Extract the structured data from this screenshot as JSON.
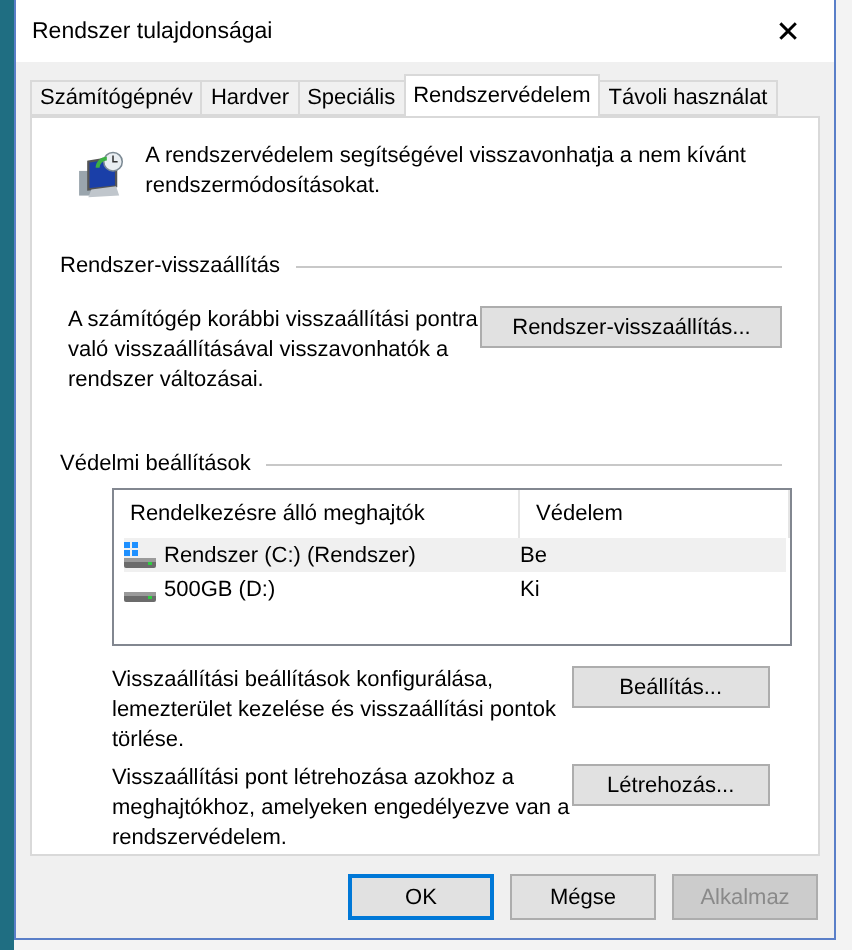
{
  "window": {
    "title": "Rendszer tulajdonságai",
    "close": "✕"
  },
  "tabs": [
    {
      "label": "Számítógépnév",
      "selected": false
    },
    {
      "label": "Hardver",
      "selected": false
    },
    {
      "label": "Speciális",
      "selected": false
    },
    {
      "label": "Rendszervédelem",
      "selected": true
    },
    {
      "label": "Távoli használat",
      "selected": false
    }
  ],
  "intro": "A rendszervédelem segítségével visszavonhatja a nem kívánt rendszermódosításokat.",
  "restore": {
    "heading": "Rendszer-visszaállítás",
    "text": "A számítógép korábbi visszaállítási pontra való visszaállításával visszavonhatók a rendszer változásai.",
    "button": "Rendszer-visszaállítás..."
  },
  "protection": {
    "heading": "Védelmi beállítások",
    "columns": [
      "Rendelkezésre álló meghajtók",
      "Védelem"
    ],
    "rows": [
      {
        "drive": "Rendszer (C:) (Rendszer)",
        "kind": "system",
        "status": "Be",
        "selected": true
      },
      {
        "drive": "500GB (D:)",
        "kind": "disk",
        "status": "Ki",
        "selected": false
      }
    ],
    "actions": [
      {
        "text": "Visszaállítási beállítások konfigurálása, lemezterület kezelése és visszaállítási pontok törlése.",
        "button": "Beállítás..."
      },
      {
        "text": "Visszaállítási pont létrehozása azokhoz a meghajtókhoz, amelyeken engedélyezve van a rendszervédelem.",
        "button": "Létrehozás..."
      }
    ]
  },
  "buttons": [
    {
      "label": "OK",
      "default": true,
      "disabled": false
    },
    {
      "label": "Mégse",
      "default": false,
      "disabled": false
    },
    {
      "label": "Alkalmaz",
      "default": false,
      "disabled": true
    }
  ]
}
